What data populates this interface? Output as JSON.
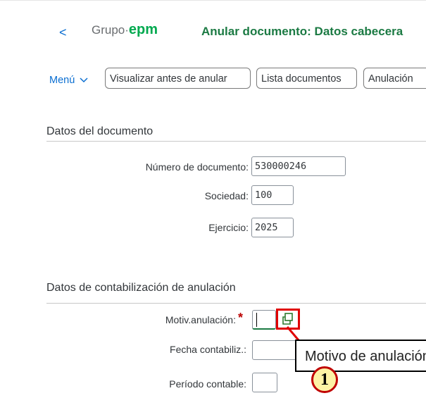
{
  "header": {
    "back_label": "<",
    "logo_prefix": "Grupo·",
    "logo_brand": "epm",
    "title": "Anular documento: Datos cabecera"
  },
  "toolbar": {
    "menu_label": "Menú",
    "buttons": [
      "Visualizar antes de anular",
      "Lista documentos",
      "Anulación"
    ]
  },
  "document_section": {
    "title": "Datos del documento",
    "fields": [
      {
        "label": "Número de documento:",
        "value": "530000246"
      },
      {
        "label": "Sociedad:",
        "value": "100"
      },
      {
        "label": "Ejercicio:",
        "value": "2025"
      }
    ]
  },
  "reversal_section": {
    "title": "Datos de contabilización de anulación",
    "reason_label": "Motiv.anulación:",
    "reason_required_mark": "*",
    "reason_value": "",
    "posting_date_label": "Fecha contabiliz.:",
    "posting_date_value": "",
    "period_label": "Período contable:",
    "period_value": ""
  },
  "annotation": {
    "tooltip_text": "Motivo de anulación",
    "step_number": "1",
    "highlight_color": "#e00000"
  },
  "colors": {
    "brand_green": "#00a94f",
    "title_green": "#1b7a43",
    "link_blue": "#0a6ed1"
  }
}
